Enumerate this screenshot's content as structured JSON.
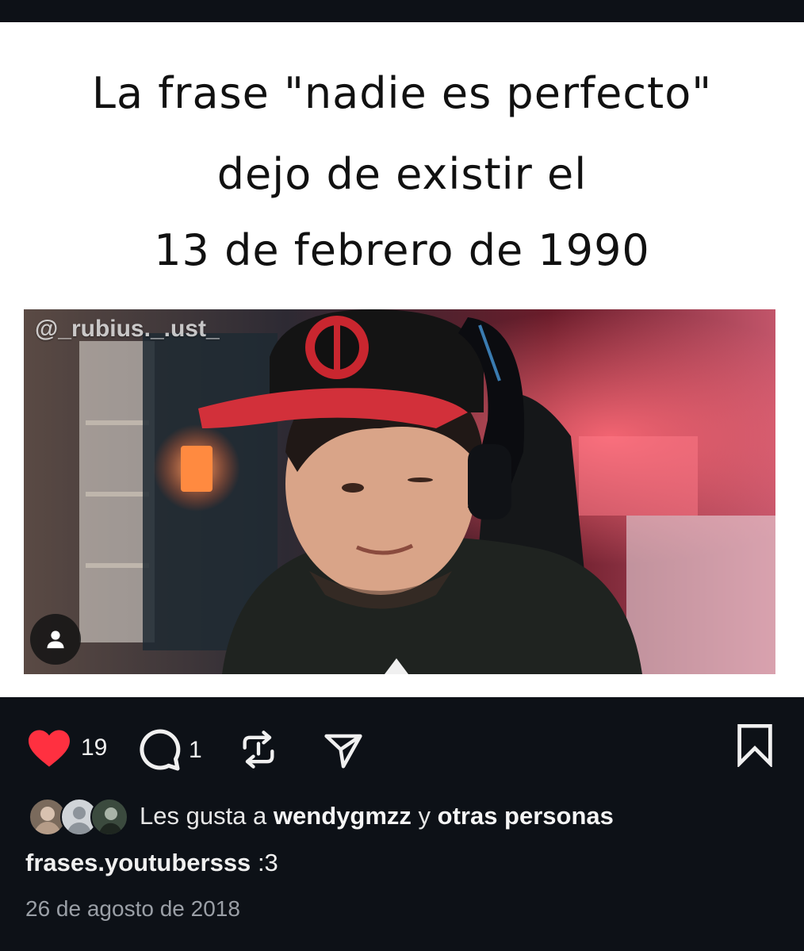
{
  "post": {
    "image_text": {
      "line1": "La frase \"nadie es perfecto\"",
      "line2": "dejo de existir el",
      "line3": "13 de febrero de 1990"
    },
    "watermark": "@_rubius._.ust_",
    "actions": {
      "like_count": "19",
      "comment_count": "1",
      "liked": true
    },
    "likes": {
      "prefix": "Les gusta a",
      "user": "wendygmzz",
      "connector": "y",
      "others": "otras personas"
    },
    "author": "frases.youtubersss",
    "caption": ":3",
    "date": "26 de agosto de 2018"
  },
  "colors": {
    "background": "#0d1117",
    "like_red": "#ff3040",
    "text": "#f0f0f0",
    "muted": "#9a9fa6"
  },
  "icons": [
    "heart-icon",
    "comment-icon",
    "repost-icon",
    "share-icon",
    "bookmark-icon",
    "user-tag-icon"
  ]
}
